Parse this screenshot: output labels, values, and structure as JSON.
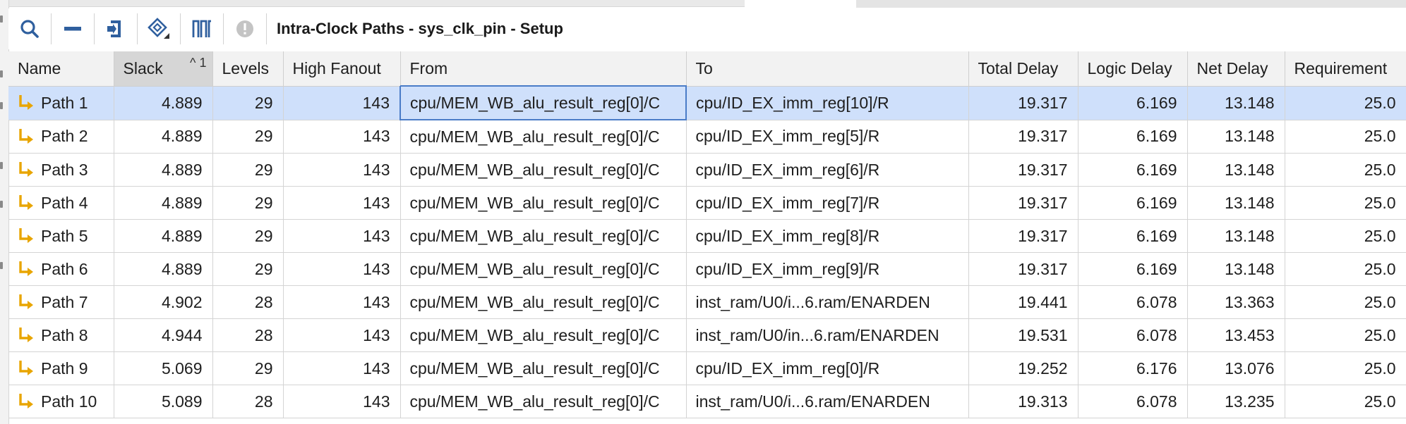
{
  "window": {
    "title": "Intra-Clock Paths - sys_clk_pin - Setup"
  },
  "toolbar": {
    "buttons": [
      {
        "icon": "search-icon"
      },
      {
        "icon": "collapse-icon"
      },
      {
        "icon": "export-timing-icon"
      },
      {
        "icon": "schematic-icon"
      },
      {
        "icon": "waveform-icon"
      },
      {
        "icon": "info-disabled-icon"
      }
    ]
  },
  "table": {
    "columns": [
      "Name",
      "Slack",
      "Levels",
      "High Fanout",
      "From",
      "To",
      "Total Delay",
      "Logic Delay",
      "Net Delay",
      "Requirement"
    ],
    "sort": {
      "column": "Slack",
      "indicator": "^",
      "order": "1"
    },
    "selected_row": 0,
    "rows": [
      {
        "name": "Path 1",
        "slack": "4.889",
        "levels": "29",
        "fanout": "143",
        "from": "cpu/MEM_WB_alu_result_reg[0]/C",
        "to": "cpu/ID_EX_imm_reg[10]/R",
        "total": "19.317",
        "logic": "6.169",
        "net": "13.148",
        "req": "25.0"
      },
      {
        "name": "Path 2",
        "slack": "4.889",
        "levels": "29",
        "fanout": "143",
        "from": "cpu/MEM_WB_alu_result_reg[0]/C",
        "to": "cpu/ID_EX_imm_reg[5]/R",
        "total": "19.317",
        "logic": "6.169",
        "net": "13.148",
        "req": "25.0"
      },
      {
        "name": "Path 3",
        "slack": "4.889",
        "levels": "29",
        "fanout": "143",
        "from": "cpu/MEM_WB_alu_result_reg[0]/C",
        "to": "cpu/ID_EX_imm_reg[6]/R",
        "total": "19.317",
        "logic": "6.169",
        "net": "13.148",
        "req": "25.0"
      },
      {
        "name": "Path 4",
        "slack": "4.889",
        "levels": "29",
        "fanout": "143",
        "from": "cpu/MEM_WB_alu_result_reg[0]/C",
        "to": "cpu/ID_EX_imm_reg[7]/R",
        "total": "19.317",
        "logic": "6.169",
        "net": "13.148",
        "req": "25.0"
      },
      {
        "name": "Path 5",
        "slack": "4.889",
        "levels": "29",
        "fanout": "143",
        "from": "cpu/MEM_WB_alu_result_reg[0]/C",
        "to": "cpu/ID_EX_imm_reg[8]/R",
        "total": "19.317",
        "logic": "6.169",
        "net": "13.148",
        "req": "25.0"
      },
      {
        "name": "Path 6",
        "slack": "4.889",
        "levels": "29",
        "fanout": "143",
        "from": "cpu/MEM_WB_alu_result_reg[0]/C",
        "to": "cpu/ID_EX_imm_reg[9]/R",
        "total": "19.317",
        "logic": "6.169",
        "net": "13.148",
        "req": "25.0"
      },
      {
        "name": "Path 7",
        "slack": "4.902",
        "levels": "28",
        "fanout": "143",
        "from": "cpu/MEM_WB_alu_result_reg[0]/C",
        "to": "inst_ram/U0/i...6.ram/ENARDEN",
        "total": "19.441",
        "logic": "6.078",
        "net": "13.363",
        "req": "25.0"
      },
      {
        "name": "Path 8",
        "slack": "4.944",
        "levels": "28",
        "fanout": "143",
        "from": "cpu/MEM_WB_alu_result_reg[0]/C",
        "to": "inst_ram/U0/in...6.ram/ENARDEN",
        "total": "19.531",
        "logic": "6.078",
        "net": "13.453",
        "req": "25.0"
      },
      {
        "name": "Path 9",
        "slack": "5.069",
        "levels": "29",
        "fanout": "143",
        "from": "cpu/MEM_WB_alu_result_reg[0]/C",
        "to": "cpu/ID_EX_imm_reg[0]/R",
        "total": "19.252",
        "logic": "6.176",
        "net": "13.076",
        "req": "25.0"
      },
      {
        "name": "Path 10",
        "slack": "5.089",
        "levels": "28",
        "fanout": "143",
        "from": "cpu/MEM_WB_alu_result_reg[0]/C",
        "to": "inst_ram/U0/i...6.ram/ENARDEN",
        "total": "19.313",
        "logic": "6.078",
        "net": "13.235",
        "req": "25.0"
      }
    ]
  },
  "colors": {
    "selection": "#cfe0fb",
    "accent": "#2f5f9e",
    "path_arrow": "#e8a500",
    "header_bg": "#f2f2f2",
    "sorted_header_bg": "#d6d6d6"
  }
}
